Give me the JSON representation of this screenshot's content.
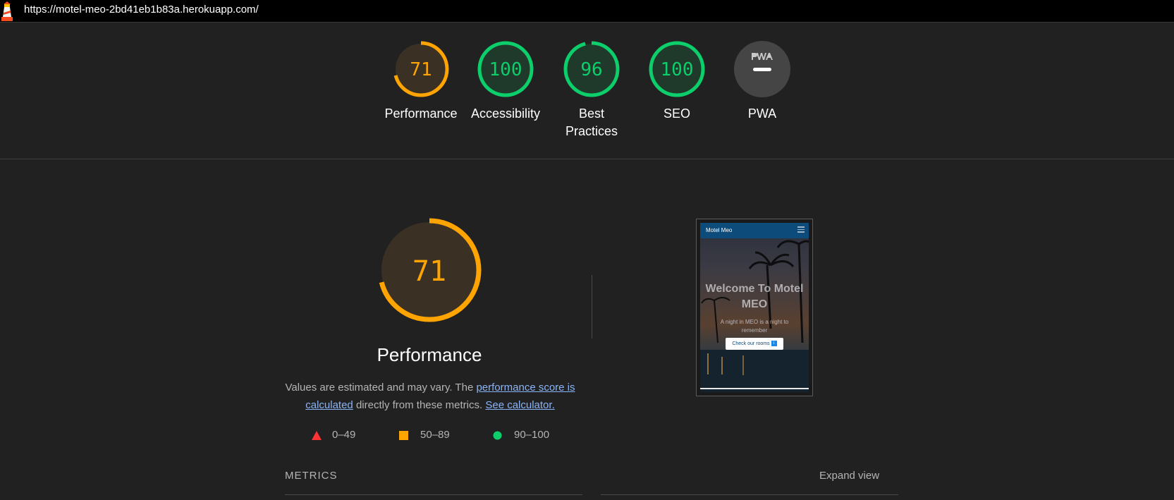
{
  "topbar": {
    "url": "https://motel-meo-2bd41eb1b83a.herokuapp.com/"
  },
  "gauges": [
    {
      "score": 71,
      "label": "Performance",
      "status": "average",
      "color": "#ffa400"
    },
    {
      "score": 100,
      "label": "Accessibility",
      "status": "pass",
      "color": "#0cce6b"
    },
    {
      "score": 96,
      "label": "Best Practices",
      "status": "pass",
      "color": "#0cce6b"
    },
    {
      "score": 100,
      "label": "SEO",
      "status": "pass",
      "color": "#0cce6b"
    },
    {
      "score": null,
      "label": "PWA",
      "status": "na",
      "icon": "pwa-icon"
    }
  ],
  "performance": {
    "score": 71,
    "title": "Performance",
    "desc_prefix": "Values are estimated and may vary. The ",
    "desc_link1": "performance score is calculated",
    "desc_middle": " directly from these metrics.",
    "desc_link2": "See calculator."
  },
  "legend": [
    {
      "range": "0–49",
      "icon": "triangle-icon",
      "color": "#ff3333"
    },
    {
      "range": "50–89",
      "icon": "square-icon",
      "color": "#ffa400"
    },
    {
      "range": "90–100",
      "icon": "circle-icon",
      "color": "#0cce6b"
    }
  ],
  "screenshot": {
    "brand": "Motel Meo",
    "heading": "Welcome To Motel MEO",
    "subheading": "A night in MEO is a night to remember",
    "button": "Check our rooms"
  },
  "metrics": {
    "label": "METRICS",
    "expand": "Expand view"
  }
}
